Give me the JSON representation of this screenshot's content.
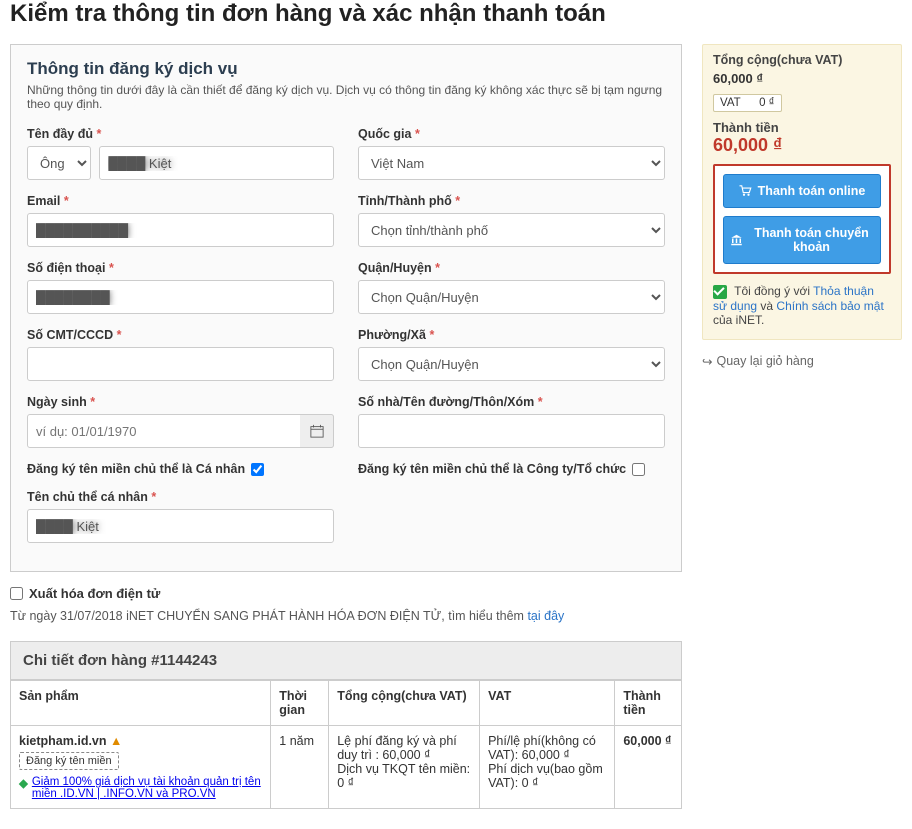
{
  "page": {
    "title": "Kiểm tra thông tin đơn hàng và xác nhận thanh toán"
  },
  "panel": {
    "title": "Thông tin đăng ký dịch vụ",
    "subtitle": "Những thông tin dưới đây là cần thiết để đăng ký dịch vụ. Dịch vụ có thông tin đăng ký không xác thực sẽ bị tạm ngưng theo quy định."
  },
  "labels": {
    "fullname": "Tên đầy đủ",
    "email": "Email",
    "phone": "Số điện thoại",
    "idnum": "Số CMT/CCCD",
    "dob": "Ngày sinh",
    "personal_reg": "Đăng ký tên miền chủ thể là Cá nhân",
    "personal_owner": "Tên chủ thể cá nhân",
    "country": "Quốc gia",
    "province": "Tỉnh/Thành phố",
    "district": "Quận/Huyện",
    "ward": "Phường/Xã",
    "address": "Số nhà/Tên đường/Thôn/Xóm",
    "company_reg": "Đăng ký tên miền chủ thể là Công ty/Tổ chức"
  },
  "values": {
    "salutation": "Ông",
    "fullname": "████ Kiệt",
    "email": "██████████",
    "phone": "████████",
    "country": "Việt Nam",
    "province": "Chọn tỉnh/thành phố",
    "district": "Chọn Quận/Huyện",
    "ward": "Chọn Quận/Huyện",
    "dob_placeholder": "ví dụ: 01/01/1970",
    "owner": "████ Kiệt"
  },
  "invoice": {
    "checkbox_label": "Xuất hóa đơn điện tử",
    "note_prefix": "Từ ngày 31/07/2018 iNET CHUYỂN SANG PHÁT HÀNH HÓA ĐƠN ĐIỆN TỬ, tìm hiểu thêm ",
    "note_link": "tại đây"
  },
  "detail": {
    "title": "Chi tiết đơn hàng #1144243",
    "headers": {
      "product": "Sản phẩm",
      "period": "Thời gian",
      "subtotal": "Tổng cộng(chưa VAT)",
      "vat": "VAT",
      "total": "Thành tiền"
    },
    "row": {
      "product_name": "kietpham.id.vn",
      "register_btn": "Đăng ký tên miền",
      "promo_text": "Giảm 100% giá dịch vụ tài khoản quản trị tên miền .ID.VN | .INFO.VN và PRO.VN",
      "period": "1 năm",
      "fee_line1": "Lệ phí đăng ký và phí duy trì : 60,000 ₫",
      "fee_line2": "Dịch vụ TKQT tên miền: 0 ₫",
      "vat_line1": "Phí/lệ phí(không có VAT): 60,000 ₫",
      "vat_line2": "Phí dịch vụ(bao gồm VAT): 0 ₫",
      "total": "60,000 ₫"
    }
  },
  "summary": {
    "subtotal_label": "Tổng cộng(chưa VAT)",
    "subtotal_value": "60,000 ₫",
    "vat_label": "VAT",
    "vat_value": "0 ₫",
    "total_label": "Thành tiền",
    "total_value": "60,000 ₫",
    "pay_online": "Thanh toán online",
    "pay_transfer": "Thanh toán chuyển khoản",
    "agree_prefix": "Tôi đồng ý với ",
    "agree_link1": "Thỏa thuận sử dụng",
    "agree_mid": " và ",
    "agree_link2": "Chính sách bảo mật",
    "agree_suffix": " của iNET.",
    "back": "Quay lại giỏ hàng"
  }
}
